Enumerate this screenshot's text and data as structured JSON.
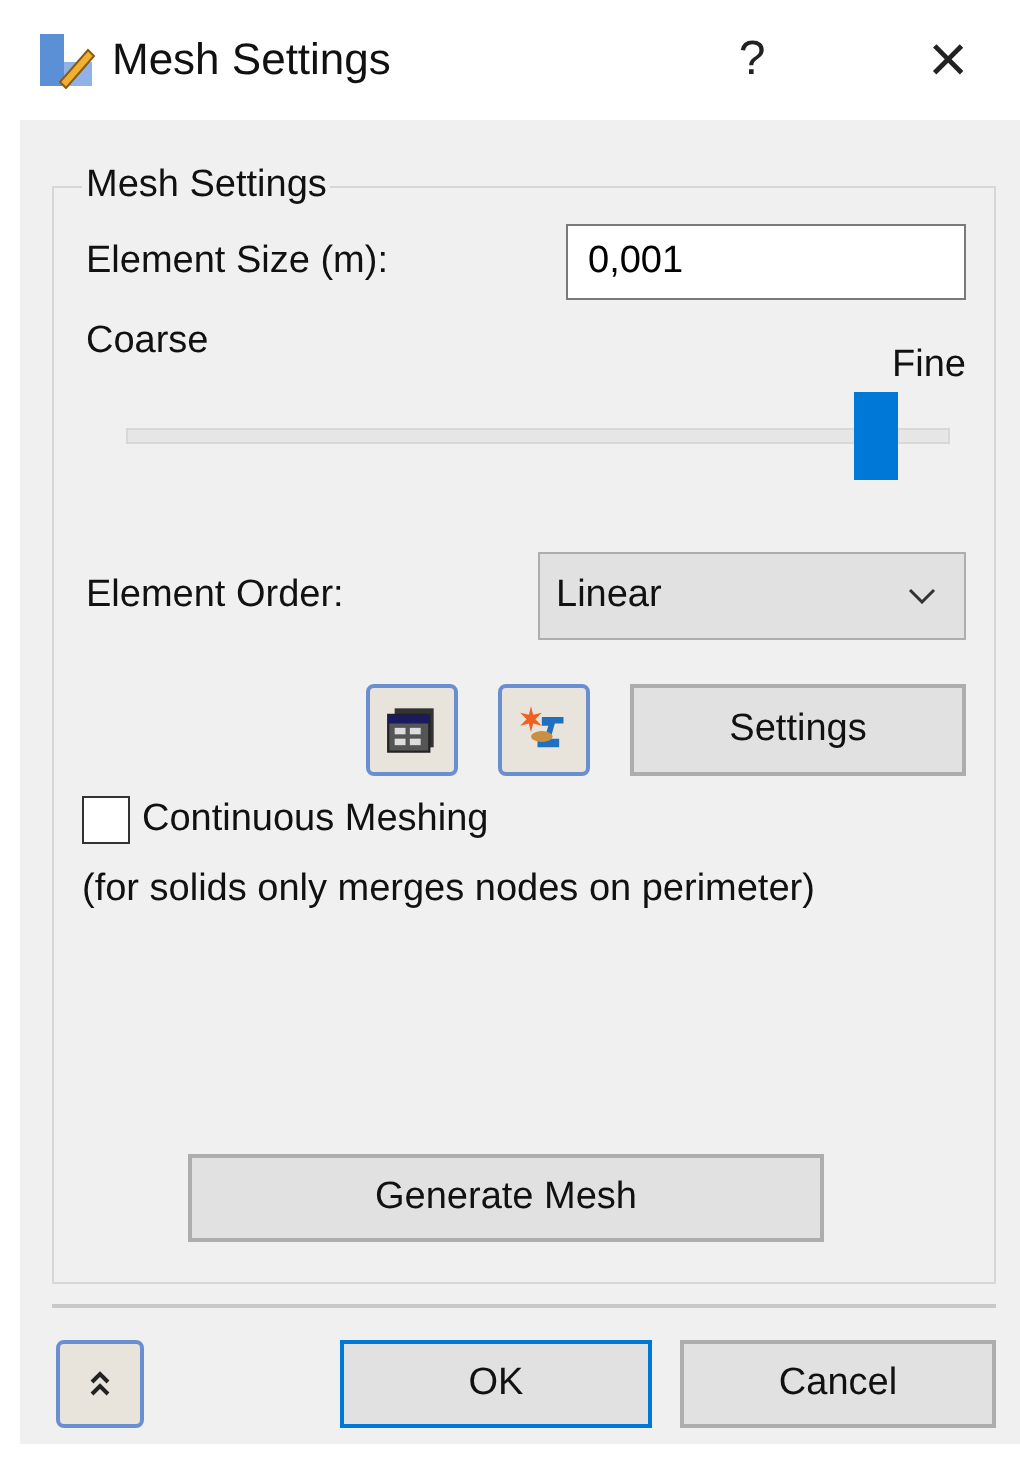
{
  "window": {
    "title": "Mesh Settings",
    "help": "?",
    "close": "×"
  },
  "group": {
    "title": "Mesh Settings",
    "element_size": {
      "label": "Element Size (m):",
      "value": "0,001"
    },
    "slider": {
      "min_label": "Coarse",
      "max_label": "Fine",
      "level": 0.91
    },
    "element_order": {
      "label": "Element Order:",
      "value": "Linear"
    },
    "settings_button": "Settings",
    "continuous_meshing": {
      "label": "Continuous Meshing",
      "checked": false
    },
    "note": "(for solids only merges nodes on perimeter)",
    "generate_button": "Generate Mesh"
  },
  "footer": {
    "ok": "OK",
    "cancel": "Cancel"
  }
}
